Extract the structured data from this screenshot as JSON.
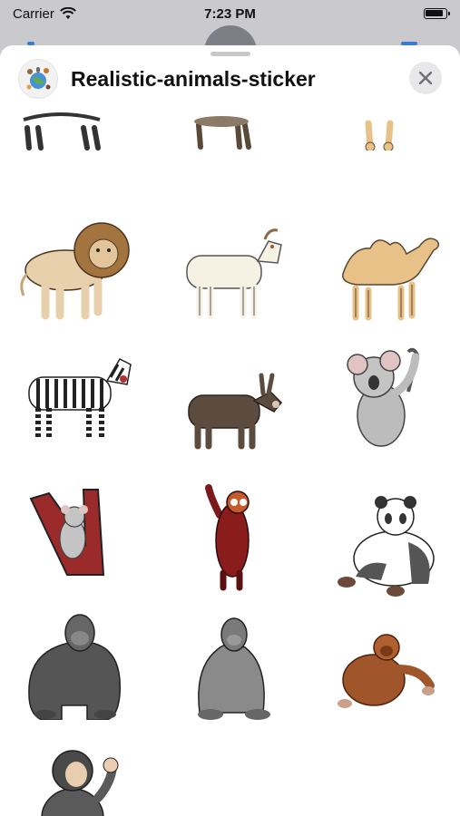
{
  "status_bar": {
    "carrier": "Carrier",
    "time": "7:23 PM"
  },
  "sheet": {
    "title": "Realistic-animals-sticker"
  },
  "colors": {
    "accent": "#3a7bd5",
    "sheet_bg": "#ffffff",
    "close_bg": "#e8e8ea"
  },
  "stickers": [
    "zebra-partial-sticker",
    "donkey-partial-sticker",
    "camel-partial-sticker",
    "lion-sticker",
    "goat-sticker",
    "camel-sticker",
    "zebra-sticker",
    "donkey-sticker",
    "koala-sticker",
    "koala-tree-sticker",
    "red-panda-sticker",
    "panda-sticker",
    "gorilla-sticker",
    "gorilla-sitting-sticker",
    "orangutan-sticker",
    "chimpanzee-sticker"
  ]
}
